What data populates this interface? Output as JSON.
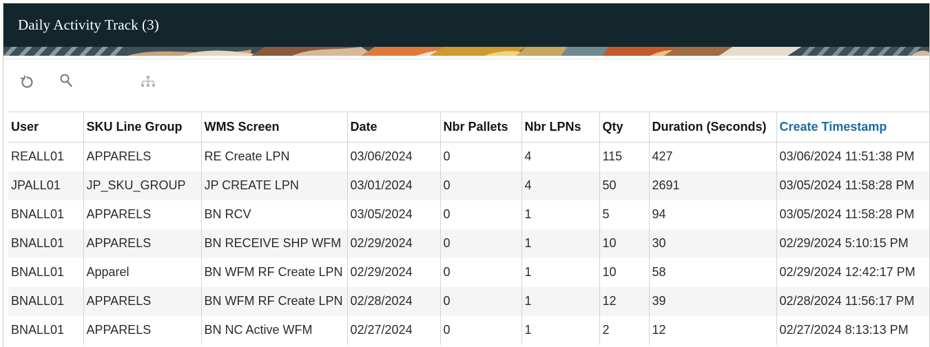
{
  "header": {
    "title": "Daily Activity Track (3)"
  },
  "toolbar": {
    "refresh_icon": "refresh-icon",
    "search_icon": "search-icon",
    "hierarchy_icon": "hierarchy-icon"
  },
  "colors": {
    "header_bg": "#13262c",
    "link": "#1e6ba1",
    "row_alt": "#f5f5f5"
  },
  "table": {
    "columns": [
      "User",
      "SKU Line Group",
      "WMS Screen",
      "Date",
      "Nbr Pallets",
      "Nbr LPNs",
      "Qty",
      "Duration (Seconds)",
      "Create Timestamp"
    ],
    "rows": [
      [
        "REALL01",
        "APPARELS",
        "RE Create LPN",
        "03/06/2024",
        "0",
        "4",
        "115",
        "427",
        "03/06/2024 11:51:38 PM"
      ],
      [
        "JPALL01",
        "JP_SKU_GROUP",
        "JP CREATE LPN",
        "03/01/2024",
        "0",
        "4",
        "50",
        "2691",
        "03/05/2024 11:58:28 PM"
      ],
      [
        "BNALL01",
        "APPARELS",
        "BN RCV",
        "03/05/2024",
        "0",
        "1",
        "5",
        "94",
        "03/05/2024 11:58:28 PM"
      ],
      [
        "BNALL01",
        "APPARELS",
        "BN RECEIVE SHP WFM",
        "02/29/2024",
        "0",
        "1",
        "10",
        "30",
        "02/29/2024 5:10:15 PM"
      ],
      [
        "BNALL01",
        "Apparel",
        "BN WFM RF Create LPN",
        "02/29/2024",
        "0",
        "1",
        "10",
        "58",
        "02/29/2024 12:42:17 PM"
      ],
      [
        "BNALL01",
        "APPARELS",
        "BN WFM RF Create LPN",
        "02/28/2024",
        "0",
        "1",
        "12",
        "39",
        "02/28/2024 11:56:17 PM"
      ],
      [
        "BNALL01",
        "APPARELS",
        "BN NC Active WFM",
        "02/27/2024",
        "0",
        "1",
        "2",
        "12",
        "02/27/2024 8:13:13 PM"
      ]
    ]
  }
}
